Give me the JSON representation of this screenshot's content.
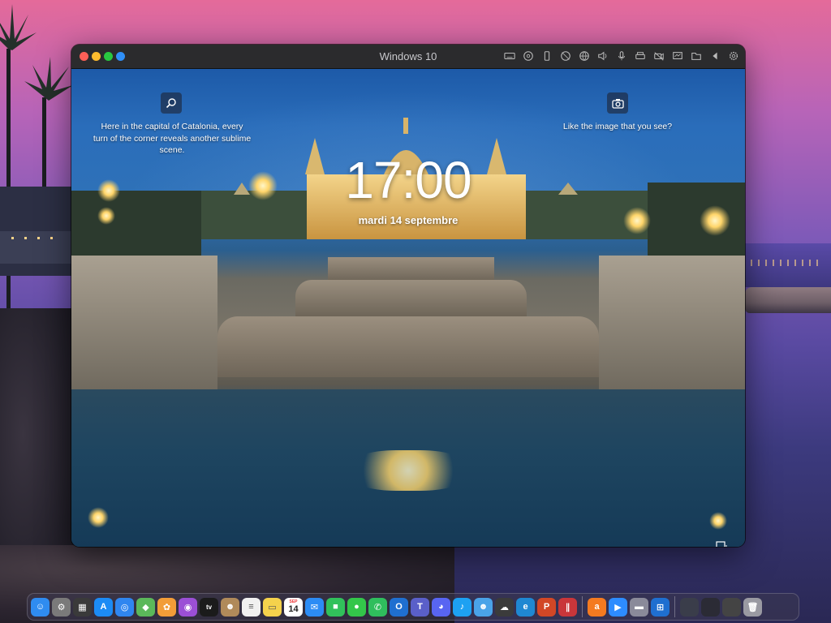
{
  "window": {
    "title": "Windows 10",
    "toolbar_icons": [
      "keyboard-icon",
      "cd-icon",
      "usb-icon",
      "network-off-icon",
      "globe-icon",
      "speaker-icon",
      "microphone-icon",
      "printer-icon",
      "camera-off-icon",
      "display-icon",
      "folder-icon",
      "arrow-left-icon",
      "settings-icon"
    ]
  },
  "lock_screen": {
    "left_spotlight": {
      "icon": "search-icon",
      "text": "Here in the capital of Catalonia, every turn of the corner reveals another sublime scene."
    },
    "right_spotlight": {
      "icon": "camera-icon",
      "text": "Like the image that you see?"
    },
    "time": "17:00",
    "date": "mardi 14 septembre"
  },
  "dock": {
    "calendar_day": "14",
    "calendar_month": "SEP",
    "apps": [
      {
        "name": "finder",
        "color": "#2f8cf0",
        "glyph": "☺"
      },
      {
        "name": "system-preferences",
        "color": "#7a7a7a",
        "glyph": "⚙"
      },
      {
        "name": "calculator",
        "color": "#3a3a3a",
        "glyph": "▦"
      },
      {
        "name": "app-store",
        "color": "#1c8bf5",
        "glyph": "A"
      },
      {
        "name": "safari",
        "color": "#2f86f0",
        "glyph": "◎"
      },
      {
        "name": "maps",
        "color": "#5bb85a",
        "glyph": "◆"
      },
      {
        "name": "photos",
        "color": "#f29d38",
        "glyph": "✿"
      },
      {
        "name": "podcasts",
        "color": "#9b4fd6",
        "glyph": "◉"
      },
      {
        "name": "apple-tv",
        "color": "#1b1b1b",
        "glyph": "tv"
      },
      {
        "name": "contacts",
        "color": "#b08a5a",
        "glyph": "☻"
      },
      {
        "name": "reminders",
        "color": "#f0f0f0",
        "glyph": "≡"
      },
      {
        "name": "notes",
        "color": "#f5d24c",
        "glyph": "▭"
      },
      {
        "name": "calendar",
        "color": "#ffffff",
        "glyph": ""
      },
      {
        "name": "mail",
        "color": "#2c8cf5",
        "glyph": "✉"
      },
      {
        "name": "facetime",
        "color": "#31c15b",
        "glyph": "■"
      },
      {
        "name": "messages",
        "color": "#33c64a",
        "glyph": "●"
      },
      {
        "name": "whatsapp",
        "color": "#2fbe5d",
        "glyph": "✆"
      },
      {
        "name": "outlook",
        "color": "#1f6fd0",
        "glyph": "O"
      },
      {
        "name": "teams",
        "color": "#5a5fc9",
        "glyph": "T"
      },
      {
        "name": "discord",
        "color": "#5865f2",
        "glyph": "◕"
      },
      {
        "name": "twitter",
        "color": "#1da1f2",
        "glyph": "♪"
      },
      {
        "name": "tweetbot",
        "color": "#4aa3e8",
        "glyph": "☻"
      },
      {
        "name": "cloud-app",
        "color": "#3b3b3b",
        "glyph": "☁"
      },
      {
        "name": "edge",
        "color": "#1f88d2",
        "glyph": "e"
      },
      {
        "name": "powerpoint",
        "color": "#d24726",
        "glyph": "P"
      },
      {
        "name": "parallels",
        "color": "#c9363a",
        "glyph": "∥"
      }
    ],
    "apps_after_sep": [
      {
        "name": "avast",
        "color": "#f47a20",
        "glyph": "a"
      },
      {
        "name": "zoom",
        "color": "#2d8cff",
        "glyph": "▶"
      },
      {
        "name": "screen-app",
        "color": "#8a8a9a",
        "glyph": "▬"
      },
      {
        "name": "windows-10",
        "color": "#1f6fd0",
        "glyph": "⊞"
      }
    ],
    "trailing": [
      {
        "name": "window-thumb-1",
        "color": "#3a3d4a",
        "glyph": ""
      },
      {
        "name": "window-thumb-2",
        "color": "#2b2b35",
        "glyph": ""
      },
      {
        "name": "window-thumb-3",
        "color": "#444",
        "glyph": ""
      },
      {
        "name": "trash",
        "color": "#9a9aa2",
        "glyph": "🗑"
      }
    ]
  }
}
